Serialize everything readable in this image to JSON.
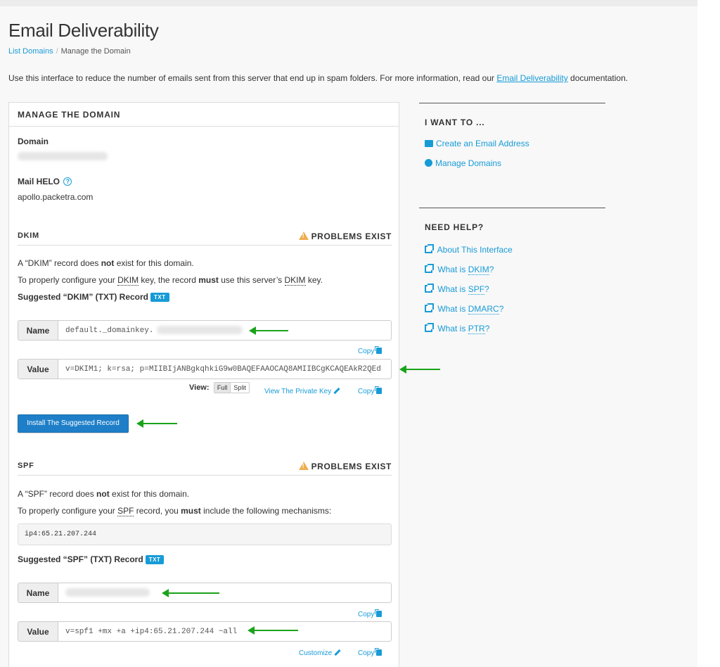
{
  "page": {
    "title": "Email Deliverability",
    "breadcrumb": {
      "parent": "List Domains",
      "separator": "/",
      "current": "Manage the Domain"
    },
    "intro": {
      "text_before": "Use this interface to reduce the number of emails sent from this server that end up in spam folders. For more information, read our ",
      "link": "Email Deliverability",
      "text_after": " documentation."
    }
  },
  "manage": {
    "header": "MANAGE THE DOMAIN",
    "domain_label": "Domain",
    "helo_label": "Mail HELO",
    "helo_help_icon": "question-circle-icon",
    "helo_value": "apollo.packetra.com"
  },
  "dkim": {
    "title": "DKIM",
    "status": "PROBLEMS EXIST",
    "line1_a": "A “DKIM” record does ",
    "line1_b": "not",
    "line1_c": " exist for this domain.",
    "line2_a": "To properly configure your ",
    "line2_abbr": "DKIM",
    "line2_b": " key, the record ",
    "line2_c": "must",
    "line2_d": " use this server’s ",
    "line2_e": " key.",
    "suggested": "Suggested “DKIM” (TXT) Record",
    "badge": "TXT",
    "name_label": "Name",
    "name_value": "default._domainkey.",
    "copy": "Copy",
    "value_label": "Value",
    "value_value": "v=DKIM1; k=rsa; p=MIIBIjANBgkqhkiG9w0BAQEFAAOCAQ8AMIIBCgKCAQEAkR2QEd",
    "view_label": "View:",
    "view_full": "Full",
    "view_split": "Split",
    "private_key": "View The Private Key",
    "install_button": "Install The Suggested Record"
  },
  "spf": {
    "title": "SPF",
    "status": "PROBLEMS EXIST",
    "line1_a": "A “SPF” record does ",
    "line1_b": "not",
    "line1_c": " exist for this domain.",
    "line2_a": "To properly configure your ",
    "line2_abbr": "SPF",
    "line2_b": " record, you ",
    "line2_c": "must",
    "line2_d": " include the following mechanisms:",
    "mechanism": "ip4:65.21.207.244",
    "suggested": "Suggested “SPF” (TXT) Record",
    "badge": "TXT",
    "name_label": "Name",
    "copy": "Copy",
    "value_label": "Value",
    "value_value": "v=spf1 +mx +a +ip4:65.21.207.244 ~all",
    "customize": "Customize"
  },
  "sidebar": {
    "want_header": "I WANT TO ...",
    "want_links": [
      "Create an Email Address",
      "Manage Domains"
    ],
    "help_header": "NEED HELP?",
    "help_about": "About This Interface",
    "help_what_is": "What is ",
    "help_dkim": "DKIM",
    "help_spf": "SPF",
    "help_dmarc": "DMARC",
    "help_ptr": "PTR",
    "help_q": "?"
  },
  "colors": {
    "link": "#179bd7",
    "warning": "#f0ad4e",
    "primary_button": "#1e7fc8",
    "annotation_arrow": "#1aa31a"
  }
}
